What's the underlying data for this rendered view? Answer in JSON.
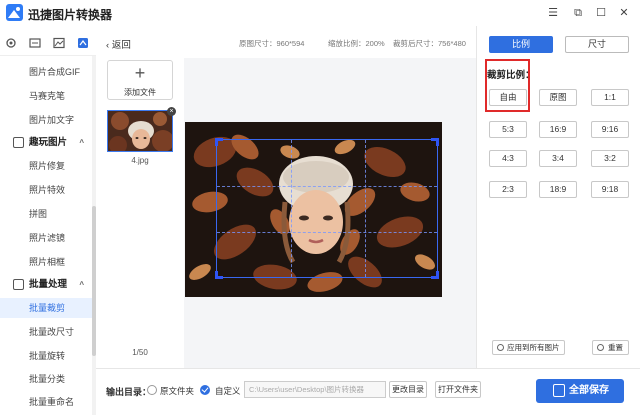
{
  "app": {
    "title": "迅捷图片转换器",
    "controls": {
      "menu": "☰",
      "restore": "⧉",
      "minimize": "—",
      "maximize": "☐",
      "close": "✕"
    }
  },
  "top_icons": [
    "gear-icon",
    "screen-icon",
    "image-icon",
    "crop-active-icon"
  ],
  "sidebar": {
    "items_a": [
      "图片合成GIF",
      "马赛克笔",
      "图片加文字"
    ],
    "group_beautify": {
      "label": "趣玩图片",
      "chevron": "^"
    },
    "items_b": [
      "照片修复",
      "照片特效",
      "拼图",
      "照片滤镜",
      "照片相框"
    ],
    "group_batch": {
      "label": "批量处理",
      "chevron": "^"
    },
    "items_c": [
      "批量裁剪",
      "批量改尺寸",
      "批量旋转",
      "批量分类",
      "批量重命名"
    ],
    "active": "批量裁剪"
  },
  "header": {
    "back": "返回",
    "original_size": "原图尺寸：960*594",
    "zoom": "缩放比例：200%",
    "cropped_size": "裁剪后尺寸：756*480"
  },
  "thumbs": {
    "add_label": "添加文件",
    "plus": "+",
    "file_name": "4.jpg",
    "close": "×",
    "pager": "1/50"
  },
  "panel": {
    "tab_ratio": "比例",
    "tab_size": "尺寸",
    "crop_ratio_label": "裁剪比例：",
    "ratios": [
      "自由",
      "原图",
      "1:1",
      "5:3",
      "16:9",
      "9:16",
      "4:3",
      "3:4",
      "3:2",
      "2:3",
      "18:9",
      "9:18"
    ],
    "apply_all": "应用到所有图片",
    "reset": "重置"
  },
  "bottom": {
    "output_label": "输出目录：",
    "option_original": "原文件夹",
    "option_custom": "自定义",
    "path": "C:\\Users\\user\\Desktop\\图片转换器",
    "change_dir": "更改目录",
    "open_folder": "打开文件夹",
    "save_all": "全部保存"
  },
  "colors": {
    "accent": "#2f6fe0",
    "highlight": "#e02a2a",
    "crop": "#2f55f5"
  }
}
